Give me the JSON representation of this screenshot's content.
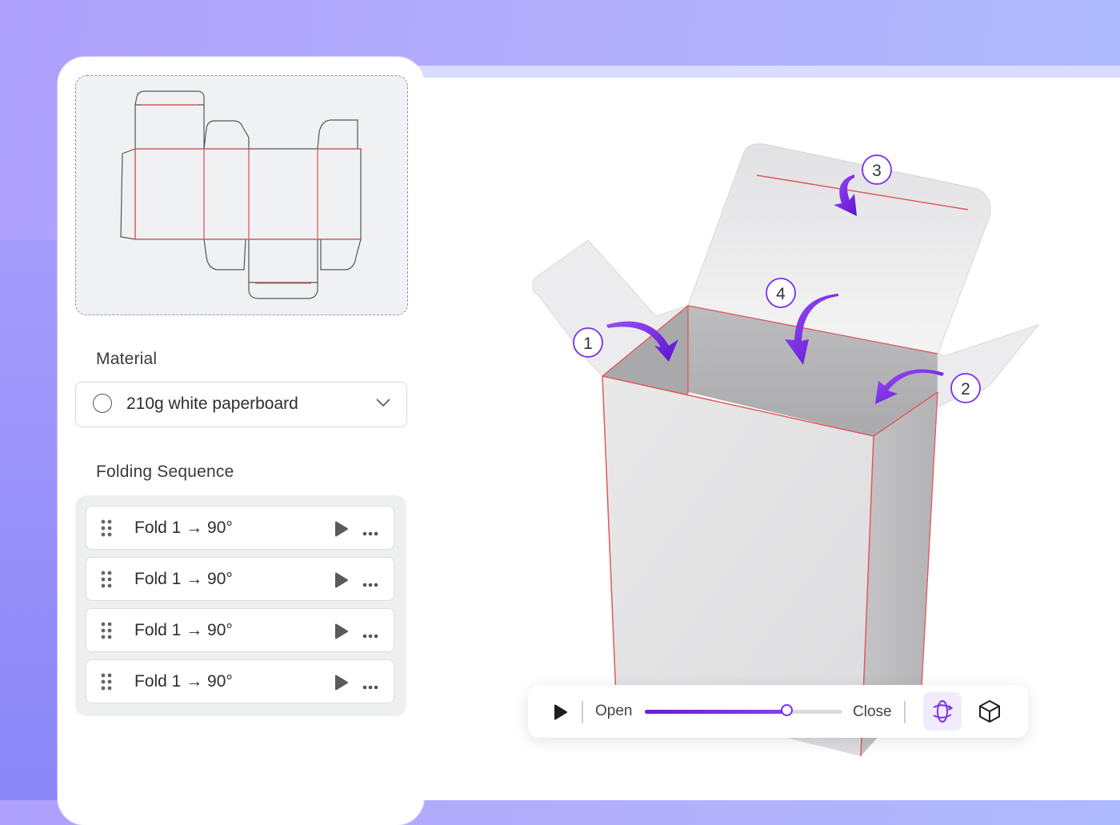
{
  "material": {
    "label": "Material",
    "selected": "210g white paperboard"
  },
  "folding_sequence": {
    "label": "Folding Sequence",
    "items": [
      {
        "text": "Fold 1 → 90°"
      },
      {
        "text": "Fold 1 → 90°"
      },
      {
        "text": "Fold 1 → 90°"
      },
      {
        "text": "Fold 1 → 90°"
      }
    ]
  },
  "markers": [
    "1",
    "2",
    "3",
    "4"
  ],
  "animation": {
    "open_label": "Open",
    "close_label": "Close",
    "progress": 0.72
  },
  "icons": [
    "drag-grip-icon",
    "play-icon",
    "more-icon",
    "chevron-down-icon",
    "orbit-icon",
    "cube-icon"
  ],
  "colors": {
    "accent": "#7a2de8",
    "fold_line": "#e0595b",
    "outline": "#555555"
  }
}
